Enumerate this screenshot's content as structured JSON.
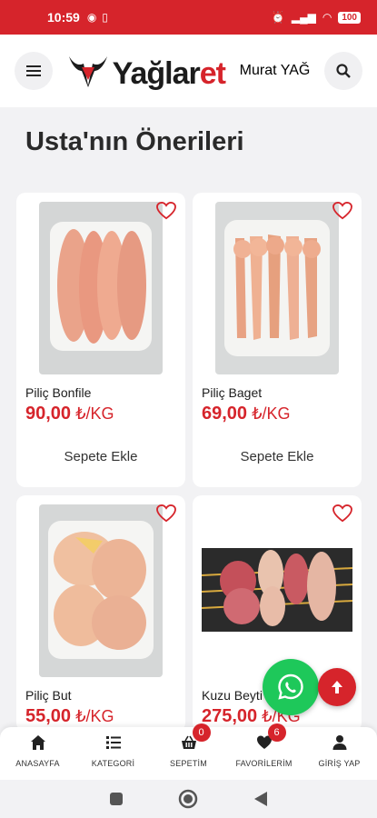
{
  "status_bar": {
    "time": "10:59",
    "battery": "100"
  },
  "header": {
    "menu_icon": "hamburger-icon",
    "logo_text_dark": "Yağlar",
    "logo_text_red": "et",
    "logo_subtitle": "Murat YAĞ",
    "search_icon": "search-icon"
  },
  "page": {
    "title": "Usta'nın Önerileri"
  },
  "products": [
    {
      "name": "Piliç Bonfile",
      "price": "90,00",
      "unit": " ₺/KG",
      "add_label": "Sepete Ekle"
    },
    {
      "name": "Piliç Baget",
      "price": "69,00",
      "unit": " ₺/KG",
      "add_label": "Sepete Ekle"
    },
    {
      "name": "Piliç But",
      "price": "55,00",
      "unit": " ₺/KG"
    },
    {
      "name": "Kuzu Beyti",
      "price": "275,00",
      "unit": " ₺/KG"
    }
  ],
  "bottom_nav": [
    {
      "label": "ANASAYFA",
      "icon": "home-icon"
    },
    {
      "label": "KATEGORİ",
      "icon": "list-icon"
    },
    {
      "label": "SEPETİM",
      "icon": "basket-icon",
      "badge": "0"
    },
    {
      "label": "FAVORİLERİM",
      "icon": "heart-icon",
      "badge": "6"
    },
    {
      "label": "GİRİŞ YAP",
      "icon": "user-icon"
    }
  ],
  "colors": {
    "brand_red": "#d6242b",
    "whatsapp_green": "#1ec85a"
  }
}
